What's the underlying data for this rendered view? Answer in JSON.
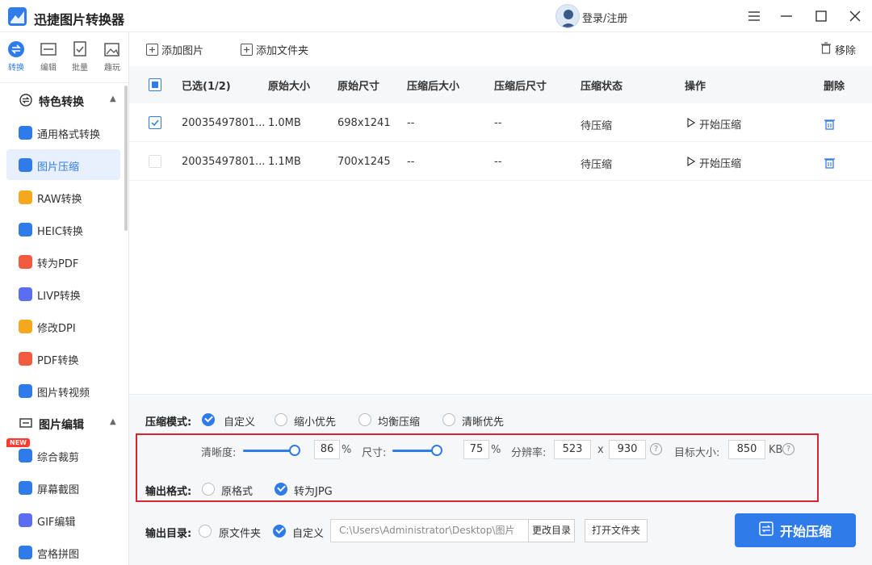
{
  "app": {
    "title": "迅捷图片转换器",
    "login_label": "登录/注册"
  },
  "top_nav": [
    {
      "label": "转换",
      "icon": "convert-icon",
      "active": true
    },
    {
      "label": "编辑",
      "icon": "edit-icon",
      "active": false
    },
    {
      "label": "批量",
      "icon": "batch-icon",
      "active": false
    },
    {
      "label": "趣玩",
      "icon": "fun-icon",
      "active": false
    }
  ],
  "sidebar": {
    "groups": [
      {
        "label": "特色转换",
        "icon": "feature-convert-icon"
      },
      {
        "label": "图片编辑",
        "icon": "image-edit-icon"
      }
    ],
    "items": [
      {
        "label": "通用格式转换",
        "icon": "general-format-icon",
        "color": "#2f7bea"
      },
      {
        "label": "图片压缩",
        "icon": "image-compress-icon",
        "color": "#2f7bea",
        "active": true
      },
      {
        "label": "RAW转换",
        "icon": "raw-icon",
        "color": "#f4a91c"
      },
      {
        "label": "HEIC转换",
        "icon": "heic-icon",
        "color": "#2f7bea"
      },
      {
        "label": "转为PDF",
        "icon": "to-pdf-icon",
        "color": "#f25a3f"
      },
      {
        "label": "LIVP转换",
        "icon": "livp-icon",
        "color": "#5b6df0"
      },
      {
        "label": "修改DPI",
        "icon": "dpi-icon",
        "color": "#f4a91c"
      },
      {
        "label": "PDF转换",
        "icon": "pdf-convert-icon",
        "color": "#f25a3f"
      },
      {
        "label": "图片转视频",
        "icon": "image-to-video-icon",
        "color": "#2f7bea"
      },
      {
        "label": "综合裁剪",
        "icon": "crop-icon",
        "color": "#2f7bea"
      },
      {
        "label": "屏幕截图",
        "icon": "screenshot-icon",
        "color": "#2f7bea"
      },
      {
        "label": "GIF编辑",
        "icon": "gif-icon",
        "color": "#5b6df0"
      },
      {
        "label": "宫格拼图",
        "icon": "grid-puzzle-icon",
        "color": "#2f7bea"
      }
    ],
    "new_badge": "NEW"
  },
  "toolbar": {
    "add_image": "添加图片",
    "add_folder": "添加文件夹",
    "remove": "移除"
  },
  "table": {
    "headers": {
      "selected": "已选(1/2)",
      "orig_size": "原始大小",
      "orig_dim": "原始尺寸",
      "comp_size": "压缩后大小",
      "comp_dim": "压缩后尺寸",
      "status": "压缩状态",
      "action": "操作",
      "delete": "删除"
    },
    "rows": [
      {
        "name": "20035497801...",
        "orig_size": "1.0MB",
        "orig_dim": "698x1241",
        "comp_size": "--",
        "comp_dim": "--",
        "status": "待压缩",
        "action": "开始压缩",
        "checked": true
      },
      {
        "name": "20035497801...",
        "orig_size": "1.1MB",
        "orig_dim": "700x1245",
        "comp_size": "--",
        "comp_dim": "--",
        "status": "待压缩",
        "action": "开始压缩",
        "checked": false
      }
    ]
  },
  "settings": {
    "mode_label": "压缩模式:",
    "modes": [
      {
        "label": "自定义",
        "selected": true
      },
      {
        "label": "缩小优先",
        "selected": false
      },
      {
        "label": "均衡压缩",
        "selected": false
      },
      {
        "label": "清晰优先",
        "selected": false
      }
    ],
    "clarity_label": "清晰度:",
    "clarity_value": "86",
    "clarity_fraction": 0.86,
    "size_label": "尺寸:",
    "size_value": "75",
    "size_fraction": 0.75,
    "percent": "%",
    "resolution_label": "分辨率:",
    "res_w": "523",
    "res_x": "x",
    "res_h": "930",
    "target_label": "目标大小:",
    "target_value": "850",
    "target_unit": "KB",
    "help": "?",
    "format_label": "输出格式:",
    "formats": [
      {
        "label": "原格式",
        "selected": false
      },
      {
        "label": "转为JPG",
        "selected": true
      }
    ],
    "output_label": "输出目录:",
    "outputs": [
      {
        "label": "原文件夹",
        "selected": false
      },
      {
        "label": "自定义",
        "selected": true
      }
    ],
    "path": "C:\\Users\\Administrator\\Desktop\\图片",
    "change_dir": "更改目录",
    "open_folder": "打开文件夹",
    "start_button": "开始压缩"
  },
  "colors": {
    "accent": "#2f7bea",
    "highlight_border": "#d9232e"
  }
}
